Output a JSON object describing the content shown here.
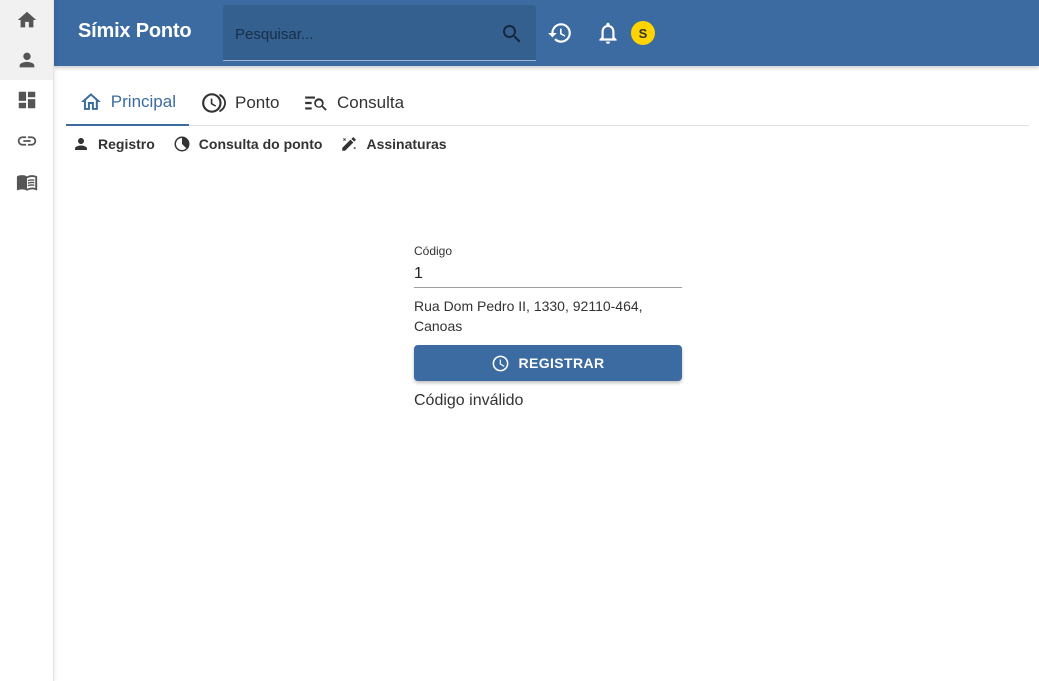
{
  "app": {
    "title": "Símix Ponto"
  },
  "search": {
    "placeholder": "Pesquisar..."
  },
  "user": {
    "avatar_initial": "S"
  },
  "colors": {
    "primary": "#3b6ba0",
    "avatar": "#ffd400"
  },
  "rail": {
    "items": [
      {
        "icon": "home-icon",
        "active": true
      },
      {
        "icon": "person-icon",
        "active": true
      },
      {
        "icon": "dashboard-icon",
        "active": false
      },
      {
        "icon": "link-icon",
        "active": false
      },
      {
        "icon": "book-icon",
        "active": false
      }
    ]
  },
  "tabs": [
    {
      "label": "Principal",
      "icon": "home-outline-icon",
      "active": true
    },
    {
      "label": "Ponto",
      "icon": "clock-ponto-icon",
      "active": false
    },
    {
      "label": "Consulta",
      "icon": "list-search-icon",
      "active": false
    }
  ],
  "subnav": [
    {
      "label": "Registro",
      "icon": "person-icon"
    },
    {
      "label": "Consulta do ponto",
      "icon": "pie-clock-icon"
    },
    {
      "label": "Assinaturas",
      "icon": "signature-icon"
    }
  ],
  "form": {
    "code_label": "Código",
    "code_value": "1",
    "address": "Rua Dom Pedro II, 1330, 92110-464, Canoas",
    "button_label": "REGISTRAR",
    "error": "Código inválido"
  }
}
